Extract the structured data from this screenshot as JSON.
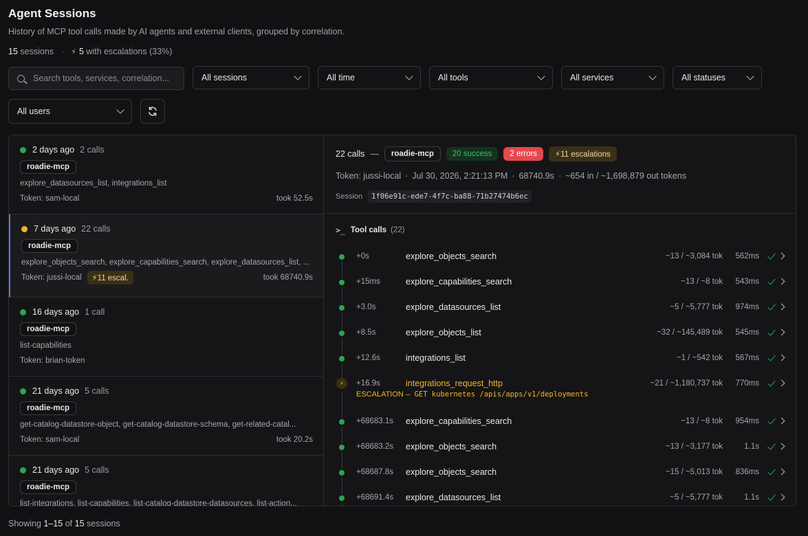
{
  "header": {
    "title": "Agent Sessions",
    "subtitle": "History of MCP tool calls made by AI agents and external clients, grouped by correlation.",
    "session_count": "15",
    "sessions_label": "sessions",
    "escalation_count": "5",
    "escalation_label": "with escalations (33%)"
  },
  "filters": {
    "search_placeholder": "Search tools, services, correlation...",
    "sessions": "All sessions",
    "time": "All time",
    "tools": "All tools",
    "services": "All services",
    "statuses": "All statuses",
    "users": "All users"
  },
  "sessions": [
    {
      "age": "2 days ago",
      "calls": "2 calls",
      "server": "roadie-mcp",
      "tools": "explore_datasources_list, integrations_list",
      "token": "Token: sam-local",
      "took": "took 52.5s",
      "status_color": "#2ea44f"
    },
    {
      "age": "7 days ago",
      "calls": "22 calls",
      "server": "roadie-mcp",
      "tools": "explore_objects_search, explore_capabilities_search, explore_datasources_list, ...",
      "token": "Token: jussi-local",
      "escal": "11 escal.",
      "took": "took 68740.9s",
      "status_color": "#f0b429"
    },
    {
      "age": "16 days ago",
      "calls": "1 call",
      "server": "roadie-mcp",
      "tools": "list-capabilities",
      "token": "Token: brian-token",
      "took": "",
      "status_color": "#2ea44f"
    },
    {
      "age": "21 days ago",
      "calls": "5 calls",
      "server": "roadie-mcp",
      "tools": "get-catalog-datastore-object, get-catalog-datastore-schema, get-related-catal...",
      "token": "Token: sam-local",
      "took": "took 20.2s",
      "status_color": "#2ea44f"
    },
    {
      "age": "21 days ago",
      "calls": "5 calls",
      "server": "roadie-mcp",
      "tools": "list-integrations, list-capabilities, list-catalog-datastore-datasources, list-action...",
      "token": "",
      "took": "",
      "status_color": "#2ea44f"
    }
  ],
  "detail": {
    "calls": "22 calls",
    "server": "roadie-mcp",
    "success": "20 success",
    "errors": "2 errors",
    "escalations": "11 escalations",
    "token": "Token: jussi-local",
    "date": "Jul 30, 2026, 2:21:13 PM",
    "duration": "68740.9s",
    "tokens": "~654 in / ~1,698,879 out tokens",
    "session_label": "Session",
    "session_id": "1f06e91c-ede7-4f7c-ba88-71b27474b6ec",
    "tool_calls_label": "Tool calls",
    "tool_calls_count": "(22)",
    "escalation_label": "ESCALATION",
    "escalation_text": "— GET kubernetes /apis/apps/v1/deployments"
  },
  "calls": [
    {
      "t": "+0s",
      "name": "explore_objects_search",
      "tok": "~13 / ~3,084 tok",
      "ms": "562ms"
    },
    {
      "t": "+15ms",
      "name": "explore_capabilities_search",
      "tok": "~13 / ~8 tok",
      "ms": "543ms"
    },
    {
      "t": "+3.0s",
      "name": "explore_datasources_list",
      "tok": "~5 / ~5,777 tok",
      "ms": "974ms"
    },
    {
      "t": "+8.5s",
      "name": "explore_objects_list",
      "tok": "~32 / ~145,489 tok",
      "ms": "545ms"
    },
    {
      "t": "+12.6s",
      "name": "integrations_list",
      "tok": "~1 / ~542 tok",
      "ms": "567ms"
    },
    {
      "t": "+16.9s",
      "name": "integrations_request_http",
      "tok": "~21 / ~1,180,737 tok",
      "ms": "770ms",
      "escalation": true
    },
    {
      "t": "+68683.1s",
      "name": "explore_capabilities_search",
      "tok": "~13 / ~8 tok",
      "ms": "954ms"
    },
    {
      "t": "+68683.2s",
      "name": "explore_objects_search",
      "tok": "~13 / ~3,177 tok",
      "ms": "1.1s"
    },
    {
      "t": "+68687.8s",
      "name": "explore_objects_search",
      "tok": "~15 / ~5,013 tok",
      "ms": "836ms"
    },
    {
      "t": "+68691.4s",
      "name": "explore_datasources_list",
      "tok": "~5 / ~5,777 tok",
      "ms": "1.1s"
    }
  ],
  "footer": {
    "showing": "Showing",
    "range": "1–15",
    "of": "of",
    "total": "15",
    "unit": "sessions"
  }
}
